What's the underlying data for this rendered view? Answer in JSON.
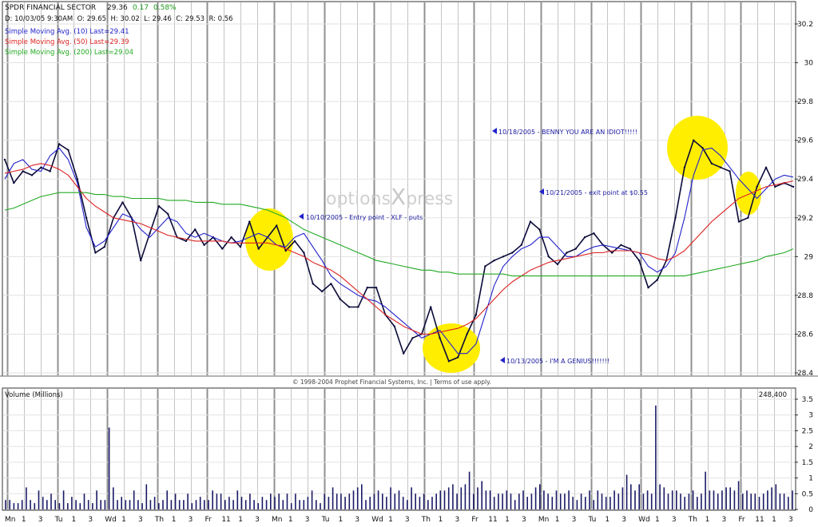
{
  "header": {
    "symbol_name": "SPDR FINANCIAL SECTOR",
    "last": "29.36",
    "change": "0.17",
    "change_pct": "0.58%",
    "ohlc": "D: 10/03/05 9:30AM  O: 29.65  H: 30.02  L: 29.46  C: 29.53  R: 0.56"
  },
  "indicators": [
    {
      "label": "Simple Moving Avg. (10) Last=29.41",
      "color": "#2222cc"
    },
    {
      "label": "Simple Moving Avg. (50) Last=29.39",
      "color": "#dd2222"
    },
    {
      "label": "Simple Moving Avg. (200) Last=29.04",
      "color": "#22aa22"
    }
  ],
  "watermark": {
    "part1": "options",
    "part2": "X",
    "part3": "press"
  },
  "copyright": "© 1998-2004 Prophet Financial Systems, Inc. | Terms of use apply.",
  "volume": {
    "title": "Volume (Millions)",
    "last": "248,400"
  },
  "annotations": [
    {
      "text": "10/10/2005 - Entry point - XLF - puts"
    },
    {
      "text": "10/13/2005 - I'M A GENIUS!!!!!!!"
    },
    {
      "text": "10/18/2005 - BENNY YOU ARE AN IDIOT!!!!!"
    },
    {
      "text": "10/21/2005 - exit point at $0.55"
    }
  ],
  "colors": {
    "price": "#0a0a3a",
    "sma10": "#2222cc",
    "sma50": "#dd2222",
    "sma200": "#22aa22",
    "highlight": "#ffee00",
    "volume": "#1a1a66",
    "grid": "#b0b0b0"
  },
  "chart_data": {
    "type": "line",
    "title": "SPDR FINANCIAL SECTOR",
    "ylim": [
      28.4,
      30.2
    ],
    "y_ticks": [
      "30.2",
      "30",
      "29.8",
      "29.6",
      "29.4",
      "29.2",
      "29",
      "28.8",
      "28.6",
      "28.4"
    ],
    "x_tick_labels": [
      "Mn",
      "1",
      "3",
      "Tu",
      "1",
      "3",
      "Wd",
      "1",
      "3",
      "Th",
      "1",
      "3",
      "Fr",
      "11",
      "1",
      "3",
      "Mn",
      "1",
      "3",
      "Tu",
      "1",
      "3",
      "Wd",
      "1",
      "3",
      "Th",
      "1",
      "3",
      "Fr",
      "11",
      "1",
      "3",
      "Mn",
      "1",
      "3",
      "Tu",
      "1",
      "3",
      "Wd",
      "1",
      "3",
      "Th",
      "1",
      "3",
      "Fr",
      "11",
      "1",
      "3"
    ],
    "series": [
      {
        "name": "Simple Moving Avg. (10) Last=29.41",
        "values": [
          29.4,
          29.48,
          29.5,
          29.45,
          29.44,
          29.52,
          29.56,
          29.5,
          29.38,
          29.15,
          29.05,
          29.08,
          29.15,
          29.22,
          29.2,
          29.14,
          29.1,
          29.15,
          29.2,
          29.18,
          29.12,
          29.1,
          29.12,
          29.1,
          29.08,
          29.07,
          29.08,
          29.1,
          29.12,
          29.1,
          29.06,
          29.05,
          29.1,
          29.12,
          29.05,
          28.98,
          28.9,
          28.86,
          28.83,
          28.8,
          28.78,
          28.77,
          28.74,
          28.7,
          28.66,
          28.62,
          28.58,
          28.6,
          28.62,
          28.56,
          28.5,
          28.5,
          28.55,
          28.7,
          28.85,
          28.95,
          29.0,
          29.04,
          29.06,
          29.1,
          29.1,
          29.05,
          29.0,
          29.0,
          29.03,
          29.05,
          29.06,
          29.05,
          29.04,
          29.03,
          29.02,
          28.95,
          28.92,
          28.95,
          29.02,
          29.2,
          29.42,
          29.55,
          29.56,
          29.52,
          29.46,
          29.4,
          29.35,
          29.3,
          29.35,
          29.4,
          29.42,
          29.41
        ]
      },
      {
        "name": "Simple Moving Avg. (50) Last=29.39",
        "values": [
          29.43,
          29.44,
          29.45,
          29.47,
          29.48,
          29.47,
          29.45,
          29.42,
          29.36,
          29.3,
          29.26,
          29.23,
          29.2,
          29.19,
          29.18,
          29.17,
          29.15,
          29.13,
          29.11,
          29.1,
          29.09,
          29.08,
          29.08,
          29.08,
          29.08,
          29.07,
          29.07,
          29.07,
          29.07,
          29.07,
          29.06,
          29.04,
          29.02,
          29.0,
          28.97,
          28.95,
          28.93,
          28.9,
          28.86,
          28.82,
          28.78,
          28.74,
          28.7,
          28.67,
          28.64,
          28.62,
          28.6,
          28.6,
          28.61,
          28.62,
          28.63,
          28.65,
          28.68,
          28.73,
          28.78,
          28.83,
          28.87,
          28.9,
          28.93,
          28.95,
          28.97,
          28.98,
          28.99,
          29.0,
          29.01,
          29.02,
          29.02,
          29.03,
          29.03,
          29.03,
          29.02,
          29.01,
          28.99,
          28.98,
          29.0,
          29.03,
          29.08,
          29.13,
          29.18,
          29.22,
          29.26,
          29.3,
          29.32,
          29.34,
          29.36,
          29.37,
          29.38,
          29.39
        ]
      },
      {
        "name": "Simple Moving Avg. (200) Last=29.04",
        "values": [
          29.24,
          29.25,
          29.27,
          29.29,
          29.31,
          29.32,
          29.33,
          29.33,
          29.33,
          29.33,
          29.32,
          29.32,
          29.31,
          29.31,
          29.3,
          29.3,
          29.3,
          29.3,
          29.29,
          29.29,
          29.29,
          29.28,
          29.28,
          29.28,
          29.27,
          29.27,
          29.27,
          29.26,
          29.25,
          29.24,
          29.22,
          29.2,
          29.17,
          29.14,
          29.12,
          29.1,
          29.08,
          29.06,
          29.04,
          29.02,
          29.0,
          28.98,
          28.97,
          28.96,
          28.95,
          28.94,
          28.93,
          28.93,
          28.92,
          28.92,
          28.91,
          28.91,
          28.91,
          28.91,
          28.91,
          28.91,
          28.9,
          28.9,
          28.9,
          28.9,
          28.9,
          28.9,
          28.9,
          28.9,
          28.9,
          28.9,
          28.9,
          28.9,
          28.9,
          28.9,
          28.9,
          28.9,
          28.9,
          28.9,
          28.9,
          28.9,
          28.91,
          28.92,
          28.93,
          28.94,
          28.95,
          28.96,
          28.97,
          28.98,
          29.0,
          29.01,
          29.02,
          29.04
        ]
      },
      {
        "name": "price",
        "values": [
          29.5,
          29.38,
          29.44,
          29.42,
          29.46,
          29.44,
          29.58,
          29.55,
          29.4,
          29.2,
          29.02,
          29.05,
          29.2,
          29.28,
          29.2,
          28.98,
          29.12,
          29.26,
          29.22,
          29.1,
          29.08,
          29.14,
          29.06,
          29.1,
          29.04,
          29.1,
          29.05,
          29.18,
          29.04,
          29.1,
          29.16,
          29.03,
          29.08,
          29.02,
          28.86,
          28.82,
          28.86,
          28.78,
          28.74,
          28.74,
          28.84,
          28.84,
          28.7,
          28.64,
          28.5,
          28.58,
          28.6,
          28.74,
          28.58,
          28.46,
          28.48,
          28.6,
          28.7,
          28.95,
          28.98,
          29.0,
          29.02,
          29.06,
          29.18,
          29.14,
          29.0,
          28.96,
          29.02,
          29.04,
          29.1,
          29.12,
          29.06,
          29.02,
          29.06,
          29.04,
          28.98,
          28.84,
          28.88,
          28.98,
          29.2,
          29.46,
          29.6,
          29.56,
          29.48,
          29.46,
          29.44,
          29.18,
          29.2,
          29.36,
          29.46,
          29.36,
          29.38,
          29.36
        ]
      }
    ],
    "volume_ylim": [
      0,
      3.5
    ],
    "volume_ticks": [
      "3.5",
      "3",
      "2.5",
      "2",
      "1.5",
      "1",
      "0.5",
      "0"
    ],
    "volume": [
      0.3,
      0.3,
      0.2,
      0.2,
      0.3,
      0.7,
      0.3,
      0.2,
      0.6,
      0.4,
      0.3,
      0.5,
      0.3,
      0.2,
      0.6,
      0.2,
      0.4,
      0.3,
      0.2,
      0.5,
      0.3,
      0.2,
      0.6,
      0.3,
      0.3,
      2.6,
      0.7,
      0.3,
      0.4,
      0.3,
      0.3,
      0.6,
      0.3,
      0.2,
      0.8,
      0.3,
      0.4,
      0.2,
      0.3,
      0.6,
      0.3,
      0.5,
      0.3,
      0.3,
      0.5,
      0.2,
      0.3,
      0.4,
      0.3,
      0.3,
      0.6,
      0.5,
      0.5,
      0.3,
      0.4,
      0.3,
      0.6,
      0.4,
      0.3,
      0.5,
      0.3,
      0.2,
      0.4,
      0.3,
      0.5,
      0.4,
      0.5,
      0.3,
      0.5,
      0.2,
      0.5,
      0.3,
      0.3,
      0.4,
      0.6,
      0.3,
      0.2,
      0.5,
      0.4,
      0.7,
      0.5,
      0.5,
      0.4,
      0.5,
      0.6,
      0.7,
      0.8,
      0.3,
      0.4,
      0.5,
      0.6,
      0.5,
      0.4,
      0.7,
      0.5,
      0.6,
      0.4,
      0.3,
      0.7,
      0.5,
      0.4,
      0.5,
      0.3,
      0.4,
      0.5,
      0.6,
      0.6,
      0.7,
      0.8,
      0.5,
      0.7,
      0.8,
      1.2,
      0.5,
      0.7,
      0.9,
      0.6,
      0.6,
      0.4,
      0.5,
      0.5,
      0.6,
      0.5,
      0.3,
      0.5,
      0.6,
      0.4,
      0.5,
      0.7,
      0.8,
      0.6,
      0.5,
      0.4,
      0.6,
      0.5,
      0.5,
      0.6,
      0.4,
      0.3,
      0.5,
      0.4,
      0.6,
      0.3,
      0.6,
      0.5,
      0.4,
      0.4,
      0.6,
      0.5,
      0.7,
      1.1,
      0.8,
      0.6,
      0.8,
      0.5,
      0.6,
      0.5,
      3.3,
      0.8,
      0.7,
      0.5,
      0.6,
      0.6,
      0.5,
      0.4,
      0.5,
      0.6,
      0.4,
      0.5,
      1.2,
      0.6,
      0.6,
      0.5,
      0.6,
      0.7,
      0.7,
      0.6,
      0.9,
      0.5,
      0.6,
      0.5,
      0.5,
      0.4,
      0.5,
      0.6,
      0.7,
      0.8,
      0.5,
      0.5,
      0.4,
      0.6
    ]
  }
}
